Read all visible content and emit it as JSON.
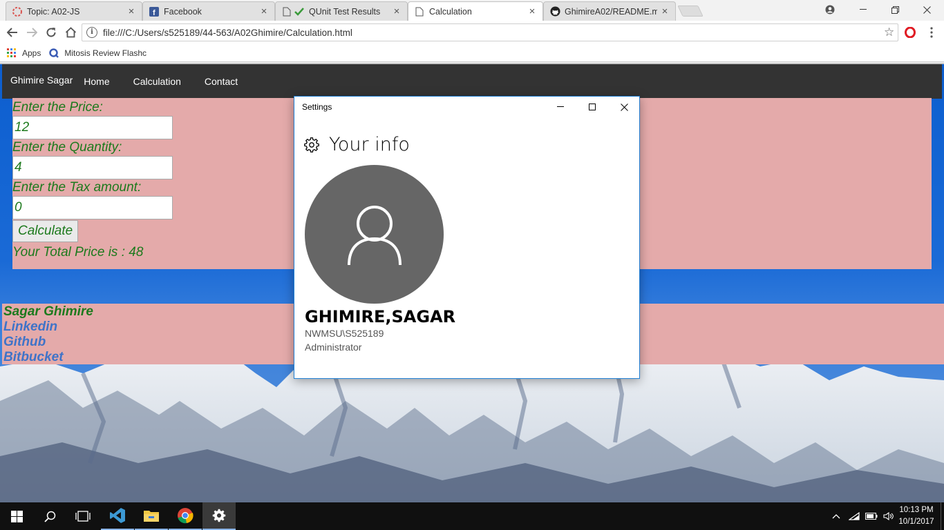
{
  "browser": {
    "tabs": [
      {
        "title": "Topic: A02-JS",
        "icon": "loading-icon",
        "active": false
      },
      {
        "title": "Facebook",
        "icon": "facebook-icon",
        "active": false
      },
      {
        "title": "QUnit Test Results",
        "icon": "page-check-icon",
        "active": false
      },
      {
        "title": "Calculation",
        "icon": "page-icon",
        "active": true
      },
      {
        "title": "GhimireA02/README.md",
        "icon": "github-icon",
        "active": false
      }
    ],
    "url": "file:///C:/Users/s525189/44-563/A02Ghimire/Calculation.html",
    "bookmarks": [
      {
        "label": "Apps",
        "icon": "apps-grid-icon"
      },
      {
        "label": "Mitosis Review Flashc",
        "icon": "quizlet-icon"
      }
    ]
  },
  "site": {
    "brand": "Ghimire Sagar",
    "nav": [
      "Home",
      "Calculation",
      "Contact"
    ],
    "form": {
      "price_label": "Enter the Price:",
      "price_value": "12",
      "quantity_label": "Enter the Quantity:",
      "quantity_value": "4",
      "tax_label": "Enter the Tax amount:",
      "tax_value": "0",
      "calculate_label": "Calculate",
      "result": "Your Total Price is : 48"
    },
    "footer": {
      "name": "Sagar Ghimire",
      "links": [
        "Linkedin",
        "Github",
        "Bitbucket"
      ]
    }
  },
  "settings": {
    "window_title": "Settings",
    "heading": "Your info",
    "user_name": "GHIMIRE,SAGAR",
    "account": "NWMSU\\S525189",
    "role": "Administrator"
  },
  "taskbar": {
    "time": "10:13 PM",
    "date": "10/1/2017"
  },
  "colors": {
    "page_panel": "#e4aaaa",
    "form_text": "#1d7a1d",
    "link_text": "#3f73c8",
    "navbar": "#333333",
    "avatar": "#666666"
  }
}
